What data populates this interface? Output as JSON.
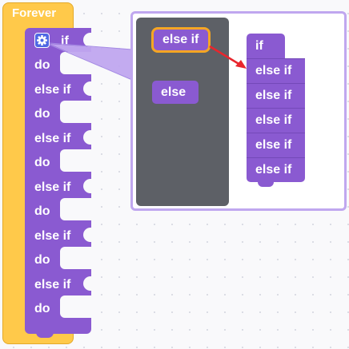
{
  "forever_block": {
    "label": "Forever"
  },
  "if_block": {
    "rows": [
      {
        "label": "if"
      },
      {
        "label": "do"
      },
      {
        "label": "else if"
      },
      {
        "label": "do"
      },
      {
        "label": "else if"
      },
      {
        "label": "do"
      },
      {
        "label": "else if"
      },
      {
        "label": "do"
      },
      {
        "label": "else if"
      },
      {
        "label": "do"
      },
      {
        "label": "else if"
      },
      {
        "label": "do"
      }
    ]
  },
  "mutator": {
    "flyout": {
      "else_if_label": "else if",
      "else_label": "else"
    },
    "workspace": {
      "stack": [
        "if",
        "else if",
        "else if",
        "else if",
        "else if",
        "else if"
      ]
    }
  },
  "colors": {
    "forever": "#ffc94a",
    "control": "#8a5ad1",
    "gear": "#4f68e4",
    "highlight": "#f5a623",
    "arrow": "#e8262d"
  },
  "icons": {
    "gear": "gear-icon"
  }
}
